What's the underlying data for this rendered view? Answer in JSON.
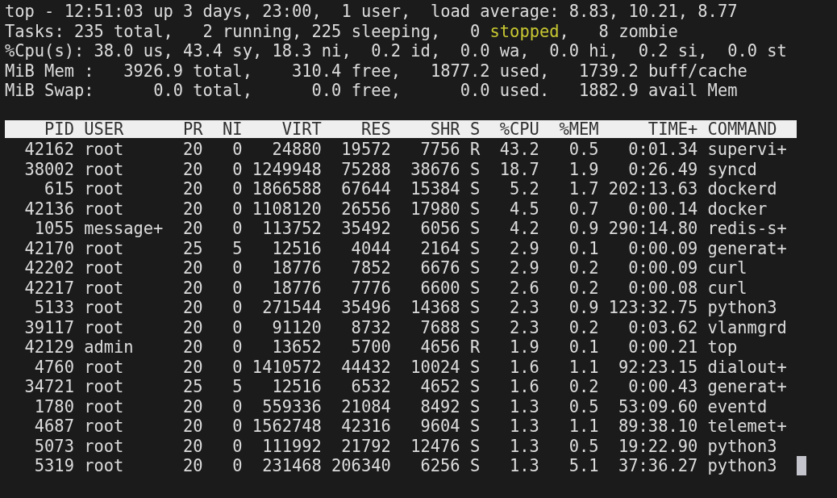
{
  "summary": [
    {
      "segments": [
        {
          "text": "top - 12:51:03 up 3 days, 23:00,  1 user,  load average: 8.83, 10.21, 8.77",
          "highlight": false
        }
      ]
    },
    {
      "segments": [
        {
          "text": "Tasks: 235 total,   2 running, 225 sleeping,   0 ",
          "highlight": false
        },
        {
          "text": "stopped",
          "highlight": true
        },
        {
          "text": ",   8 zombie",
          "highlight": false
        }
      ]
    },
    {
      "segments": [
        {
          "text": "%Cpu(s): 38.0 us, 43.4 sy, 18.3 ni,  0.2 id,  0.0 wa,  0.0 hi,  0.2 si,  0.0 st",
          "highlight": false
        }
      ]
    },
    {
      "segments": [
        {
          "text": "MiB Mem :   3926.9 total,    310.4 free,   1877.2 used,   1739.2 buff/cache",
          "highlight": false
        }
      ]
    },
    {
      "segments": [
        {
          "text": "MiB Swap:      0.0 total,      0.0 free,      0.0 used.   1882.9 avail Mem",
          "highlight": false
        }
      ]
    }
  ],
  "table": {
    "columns": [
      "PID",
      "USER",
      "PR",
      "NI",
      "VIRT",
      "RES",
      "SHR",
      "S",
      "%CPU",
      "%MEM",
      "TIME+",
      "COMMAND"
    ],
    "rows": [
      [
        "42162",
        "root",
        "20",
        "0",
        "24880",
        "19572",
        "7756",
        "R",
        "43.2",
        "0.5",
        "0:01.34",
        "supervi+"
      ],
      [
        "38002",
        "root",
        "20",
        "0",
        "1249948",
        "75288",
        "38676",
        "S",
        "18.7",
        "1.9",
        "0:26.49",
        "syncd"
      ],
      [
        "615",
        "root",
        "20",
        "0",
        "1866588",
        "67644",
        "15384",
        "S",
        "5.2",
        "1.7",
        "202:13.63",
        "dockerd"
      ],
      [
        "42136",
        "root",
        "20",
        "0",
        "1108120",
        "26556",
        "17980",
        "S",
        "4.5",
        "0.7",
        "0:00.14",
        "docker"
      ],
      [
        "1055",
        "message+",
        "20",
        "0",
        "113752",
        "35492",
        "6056",
        "S",
        "4.2",
        "0.9",
        "290:14.80",
        "redis-s+"
      ],
      [
        "42170",
        "root",
        "25",
        "5",
        "12516",
        "4044",
        "2164",
        "S",
        "2.9",
        "0.1",
        "0:00.09",
        "generat+"
      ],
      [
        "42202",
        "root",
        "20",
        "0",
        "18776",
        "7852",
        "6676",
        "S",
        "2.9",
        "0.2",
        "0:00.09",
        "curl"
      ],
      [
        "42217",
        "root",
        "20",
        "0",
        "18776",
        "7776",
        "6600",
        "S",
        "2.6",
        "0.2",
        "0:00.08",
        "curl"
      ],
      [
        "5133",
        "root",
        "20",
        "0",
        "271544",
        "35496",
        "14368",
        "S",
        "2.3",
        "0.9",
        "123:32.75",
        "python3"
      ],
      [
        "39117",
        "root",
        "20",
        "0",
        "91120",
        "8732",
        "7688",
        "S",
        "2.3",
        "0.2",
        "0:03.62",
        "vlanmgrd"
      ],
      [
        "42129",
        "admin",
        "20",
        "0",
        "13652",
        "5700",
        "4656",
        "R",
        "1.9",
        "0.1",
        "0:00.21",
        "top"
      ],
      [
        "4760",
        "root",
        "20",
        "0",
        "1410572",
        "44432",
        "10024",
        "S",
        "1.6",
        "1.1",
        "92:23.15",
        "dialout+"
      ],
      [
        "34721",
        "root",
        "25",
        "5",
        "12516",
        "6532",
        "4652",
        "S",
        "1.6",
        "0.2",
        "0:00.43",
        "generat+"
      ],
      [
        "1780",
        "root",
        "20",
        "0",
        "559336",
        "21084",
        "8492",
        "S",
        "1.3",
        "0.5",
        "53:09.60",
        "eventd"
      ],
      [
        "4687",
        "root",
        "20",
        "0",
        "1562748",
        "42316",
        "9604",
        "S",
        "1.3",
        "1.1",
        "89:38.10",
        "telemet+"
      ],
      [
        "5073",
        "root",
        "20",
        "0",
        "111992",
        "21792",
        "12476",
        "S",
        "1.3",
        "0.5",
        "19:22.90",
        "python3"
      ],
      [
        "5319",
        "root",
        "20",
        "0",
        "231468",
        "206340",
        "6256",
        "S",
        "1.3",
        "5.1",
        "37:36.27",
        "python3"
      ]
    ]
  }
}
